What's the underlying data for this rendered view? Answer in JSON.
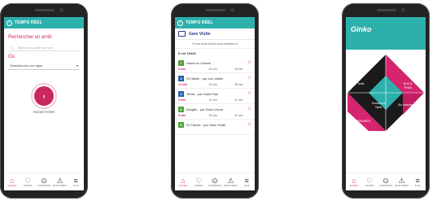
{
  "phone1": {
    "header": "TEMPS RÉEL",
    "title": "Rechercher un arrêt",
    "search_placeholder": "Tapez une partie du nom",
    "ou_label": "Ou",
    "select_value": "Sélectionnez une ligne",
    "locate_label": "ROCHE FOYER"
  },
  "phone2": {
    "header": "TEMPS RÉEL",
    "stop_name": "Gare Viotte",
    "filter_label": "Tous sens de bus sous sélection",
    "time_label": "Il est 10h43",
    "rows": [
      {
        "line": "7",
        "color": "#5a9a3a",
        "dest": "Hauts du Chazal",
        "t1": "9 min",
        "t2": "15 min",
        "t3": "18 min"
      },
      {
        "line": "4",
        "color": "#2a5ea8",
        "dest": "St Hilaire - par Les Vaites",
        "t1": "12 min",
        "t2": "29 min",
        "t3": "38 min"
      },
      {
        "line": "3",
        "color": "#2a5ea8",
        "dest": "Temis - par Saint Paul",
        "t1": "5 min",
        "t2": "10 min",
        "t3": "12 min"
      },
      {
        "line": "6",
        "color": "#4aa83a",
        "dest": "Bregille - par Saint Vivent",
        "t1": "9 min",
        "t2": "25 min",
        "t3": "42 min"
      },
      {
        "line": "5",
        "color": "#4aa83a",
        "dest": "St Claude - par Gare Viotte",
        "t1": "",
        "t2": "",
        "t3": ""
      }
    ]
  },
  "phone3": {
    "logo": "Ginko",
    "segments": {
      "top": "TEMPS RÉEL",
      "left": "Tarifs",
      "right": "BUS & TRAM",
      "center": "Horaires & Tarifs",
      "bottom_right": "Sur mesure",
      "bottom_left": "ITINÉRAIRES"
    }
  },
  "nav": {
    "items": [
      {
        "label": "ACCUEIL",
        "icon": "home-icon",
        "glyph": "⌂"
      },
      {
        "label": "FAVORIS",
        "icon": "heart-icon",
        "glyph": "♡"
      },
      {
        "label": "À PROXIMITÉ",
        "icon": "location-pin-icon",
        "glyph": "⊙"
      },
      {
        "label": "INFOS TRAFIC",
        "icon": "warning-icon",
        "glyph": "⚠"
      },
      {
        "label": "PLUS",
        "icon": "menu-icon",
        "glyph": "≡"
      }
    ]
  }
}
